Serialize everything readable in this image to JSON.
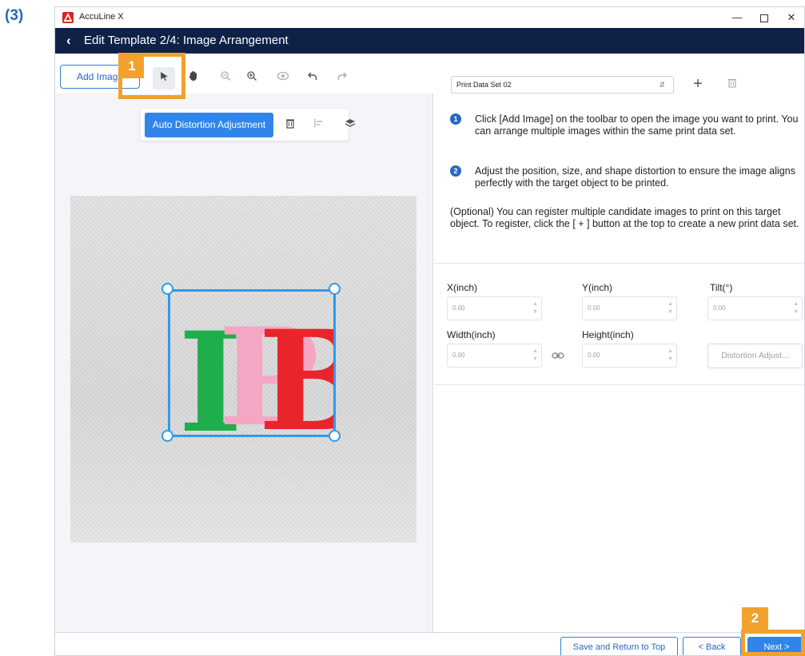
{
  "step_label": "(3)",
  "window": {
    "app_title": "AccuLine X",
    "minimize": "—",
    "close": "✕"
  },
  "header": {
    "title": "Edit Template 2/4: Image Arrangement"
  },
  "toolbar": {
    "add_image": "Add Image",
    "tools": [
      "select-arrow-icon",
      "hand-icon",
      "zoom-out-icon",
      "zoom-in-icon",
      "preview-eye-icon",
      "undo-icon",
      "redo-icon"
    ]
  },
  "context_bar": {
    "auto_distortion": "Auto Distortion Adjustment"
  },
  "callouts": {
    "one": "1",
    "two": "2"
  },
  "canvas": {
    "logo_text": "IPB",
    "logo_colors": {
      "i": "#1fae4b",
      "p": "#f4a6c4",
      "b": "#e8252b"
    },
    "selection_color": "#2a9bf0"
  },
  "right_panel": {
    "dataset": "Print Data Set 02",
    "instructions": [
      {
        "num": "1",
        "text": "Click [Add Image] on the toolbar to open the image you want to print. You can arrange multiple images within the same print data set."
      },
      {
        "num": "2",
        "text": "Adjust the position, size, and shape distortion to ensure the image aligns perfectly with the target object to be printed."
      }
    ],
    "optional": "(Optional) You can register multiple candidate images to print on this target object. To register, click the [ + ] button at the top to create a new print data set.",
    "fields": {
      "x_label": "X(inch)",
      "x_value": "0.00",
      "y_label": "Y(inch)",
      "y_value": "0.00",
      "tilt_label": "Tilt(°)",
      "tilt_value": "0.00",
      "width_label": "Width(inch)",
      "width_value": "0.00",
      "height_label": "Height(inch)",
      "height_value": "0.00",
      "distortion_button": "Distortion Adjust..."
    }
  },
  "footer": {
    "save": "Save and Return to Top",
    "back": "< Back",
    "next": "Next >"
  },
  "colors": {
    "accent": "#2f86e8",
    "header_bg": "#0f2146",
    "callout": "#f0a22c"
  }
}
